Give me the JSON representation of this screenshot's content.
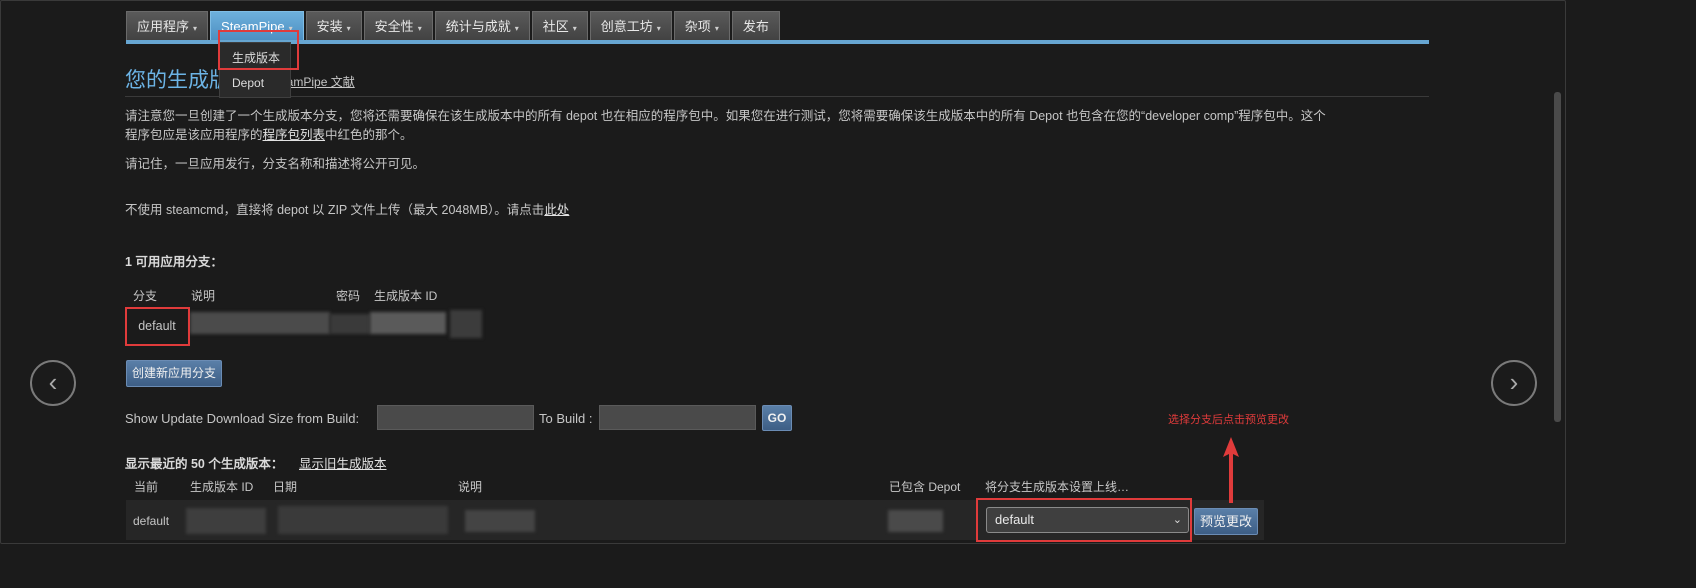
{
  "nav": {
    "tabs": [
      {
        "label": "应用程序",
        "caret": "▾"
      },
      {
        "label": "SteamPipe",
        "caret": "▾",
        "active": true
      },
      {
        "label": "安装",
        "caret": "▾"
      },
      {
        "label": "安全性",
        "caret": "▾"
      },
      {
        "label": "统计与成就",
        "caret": "▾"
      },
      {
        "label": "社区",
        "caret": "▾"
      },
      {
        "label": "创意工坊",
        "caret": "▾"
      },
      {
        "label": "杂项",
        "caret": "▾"
      },
      {
        "label": "发布",
        "caret": ""
      }
    ],
    "dropdown": [
      "生成版本",
      "Depot"
    ]
  },
  "page": {
    "title": "您的生成版",
    "doc_link": "eamPipe 文献",
    "para1_a": "请注意您一旦创建了一个生成版本分支，您将还需要确保在该生成版本中的所有 depot 也在相应的程序包中。如果您在进行测试，您将需要确保该生成版本中的所有 Depot 也包含在您的“developer comp”程序包中。这个",
    "para1_b_pre": "程序包应是该应用程序的",
    "para1_b_link": "程序包列表",
    "para1_b_post": "中红色的那个。",
    "para2": "请记住，一旦应用发行，分支名称和描述将公开可见。",
    "para3_pre": "不使用 steamcmd，直接将 depot 以 ZIP 文件上传（最大 2048MB）。请点击",
    "para3_link": "此处"
  },
  "branches": {
    "heading": "1 可用应用分支：",
    "columns": [
      "分支",
      "说明",
      "密码",
      "生成版本 ID"
    ],
    "rows": [
      {
        "branch": "default"
      }
    ],
    "create_button": "创建新应用分支"
  },
  "download_size": {
    "from_label": "Show Update Download Size from Build:",
    "to_label": "To Build :",
    "go_button": "GO"
  },
  "builds": {
    "heading": "显示最近的 50 个生成版本：",
    "show_old_link": "显示旧生成版本",
    "columns": [
      "当前",
      "生成版本 ID",
      "日期",
      "说明",
      "已包含 Depot",
      "将分支生成版本设置上线…"
    ],
    "rows": [
      {
        "current": "default",
        "select_value": "default",
        "preview_button": "预览更改"
      }
    ]
  },
  "annotation": {
    "text": "选择分支后点击预览更改",
    "color": "#e03b3b"
  },
  "carousel": {
    "prev_icon": "‹",
    "next_icon": "›"
  },
  "colors": {
    "accent": "#67a6d2",
    "title": "#6cb4e6",
    "highlight": "#e03b3b"
  }
}
